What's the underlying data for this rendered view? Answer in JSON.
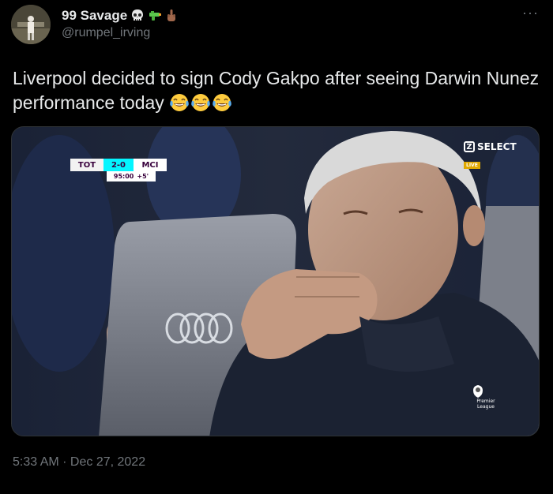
{
  "author": {
    "display_name": "99 Savage",
    "name_emojis": [
      "skull-emoji",
      "water-pistol-emoji",
      "middle-finger-emoji"
    ],
    "handle": "@rumpel_irving",
    "more_label": "···"
  },
  "tweet": {
    "text": "Liverpool decided to sign Cody Gakpo after seeing Darwin Nunez performance today",
    "emojis": [
      "tears-of-joy-emoji",
      "tears-of-joy-emoji",
      "tears-of-joy-emoji"
    ],
    "timestamp": "5:33 AM · Dec 27, 2022"
  },
  "media": {
    "scoreboard": {
      "home_team": "TOT",
      "score": "2-0",
      "away_team": "MCI",
      "clock": "95:00",
      "added_time": "+5'"
    },
    "broadcaster": {
      "logo_letter": "Z",
      "name": "SELECT",
      "live_label": "LIVE"
    },
    "watermark": {
      "line1": "Premier",
      "line2": "League"
    }
  },
  "colors": {
    "background": "#000000",
    "text_primary": "#e7e9ea",
    "text_secondary": "#71767b",
    "pl_purple": "#38003c",
    "pl_cyan": "#04f5ff"
  }
}
